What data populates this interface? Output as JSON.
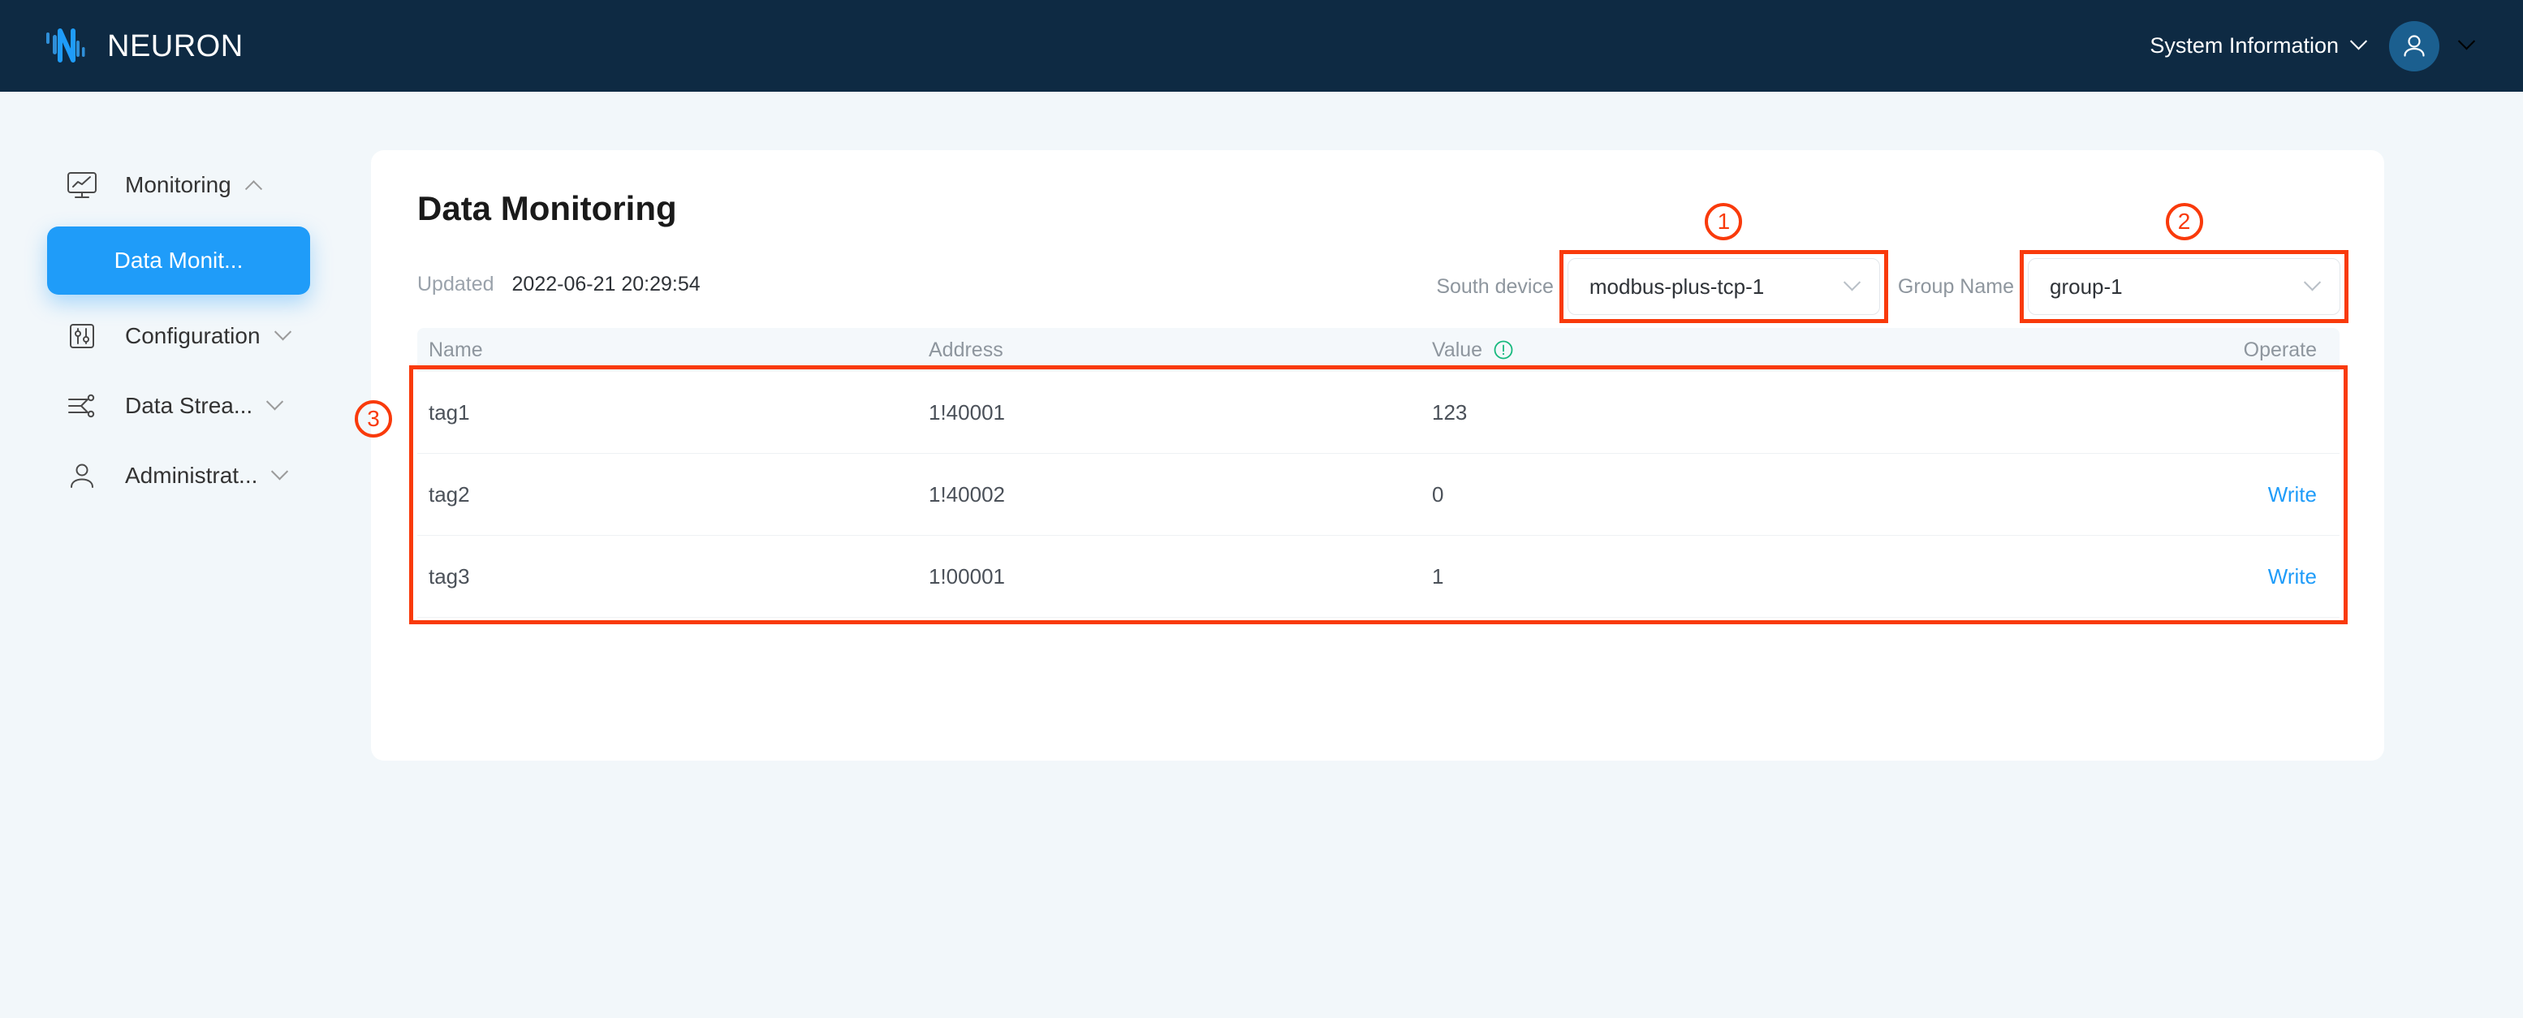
{
  "topbar": {
    "brand": "NEURON",
    "logo_icon": "neuron-logo-icon",
    "system_information_label": "System Information",
    "system_information_caret_icon": "chevron-down-icon",
    "avatar_icon": "user-avatar-icon",
    "avatar_caret_icon": "chevron-down-icon",
    "background_color": "#0e2a43",
    "accent_color": "#1f9cf9"
  },
  "sidebar": {
    "items": [
      {
        "label": "Monitoring",
        "icon": "monitor-chart-icon",
        "caret": "chevron-up-icon",
        "expanded": true
      },
      {
        "label": "Configuration",
        "icon": "sliders-icon",
        "caret": "chevron-down-icon",
        "expanded": false
      },
      {
        "label": "Data Strea...",
        "icon": "data-stream-icon",
        "caret": "chevron-down-icon",
        "expanded": false
      },
      {
        "label": "Administrat...",
        "icon": "user-icon",
        "caret": "chevron-down-icon",
        "expanded": false
      }
    ],
    "active_sub_item": "Data Monit..."
  },
  "main": {
    "title": "Data Monitoring",
    "updated_label": "Updated",
    "updated_value": "2022-06-21 20:29:54",
    "selectors": [
      {
        "label": "South device",
        "value": "modbus-plus-tcp-1",
        "caret_icon": "chevron-down-icon",
        "annotation": "1"
      },
      {
        "label": "Group Name",
        "value": "group-1",
        "caret_icon": "chevron-down-icon",
        "annotation": "2"
      }
    ],
    "table": {
      "annotation": "3",
      "columns": [
        "Name",
        "Address",
        "Value",
        "Operate"
      ],
      "value_info_icon": "info-exclamation-icon",
      "value_info_color": "#17b97e",
      "rows": [
        {
          "name": "tag1",
          "address": "1!40001",
          "value": "123",
          "operate": ""
        },
        {
          "name": "tag2",
          "address": "1!40002",
          "value": "0",
          "operate": "Write"
        },
        {
          "name": "tag3",
          "address": "1!00001",
          "value": "1",
          "operate": "Write"
        }
      ]
    }
  },
  "annotation_color": "#f93a0b"
}
